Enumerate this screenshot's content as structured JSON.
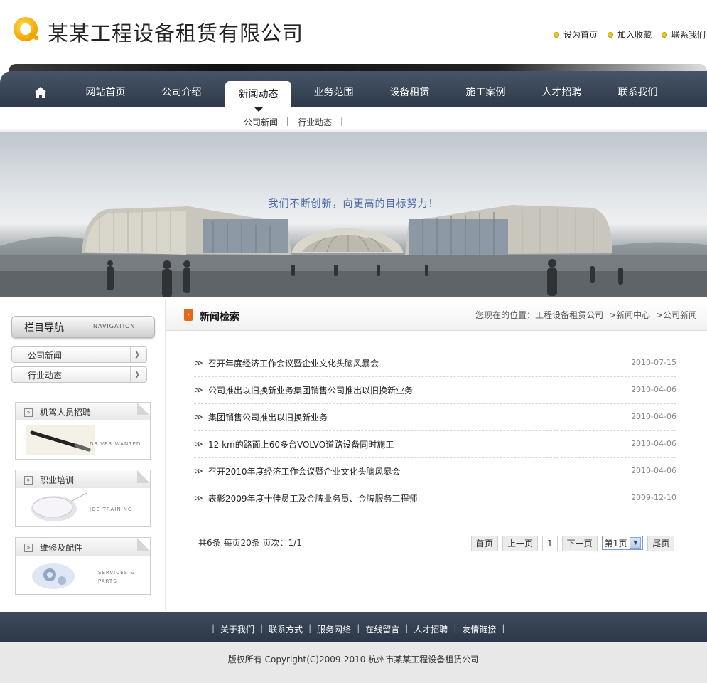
{
  "header": {
    "company_name": "某某工程设备租赁有限公司",
    "quick_links": [
      "设为首页",
      "加入收藏",
      "联系我们"
    ]
  },
  "nav": {
    "items": [
      "网站首页",
      "公司介绍",
      "新闻动态",
      "业务范围",
      "设备租赁",
      "施工案例",
      "人才招聘",
      "联系我们"
    ],
    "active": "新闻动态",
    "subnav": [
      "公司新闻",
      "行业动态"
    ]
  },
  "banner": {
    "slogan": "我们不断创新，向更高的目标努力！"
  },
  "sidebar": {
    "heading": "栏目导航",
    "heading_en": "NAVIGATION",
    "items": [
      "公司新闻",
      "行业动态"
    ],
    "promos": [
      {
        "title": "机驾人员招聘",
        "en": "DRIVER WANTED"
      },
      {
        "title": "职业培训",
        "en": "JOB TRAINING"
      },
      {
        "title": "维修及配件",
        "en_line1": "SERVICES &",
        "en_line2": "PARTS"
      }
    ]
  },
  "main": {
    "title": "新闻检索",
    "breadcrumb": {
      "prefix": "您现在的位置：",
      "items": [
        "工程设备租赁公司",
        "新闻中心",
        "公司新闻"
      ]
    },
    "news": [
      {
        "title": "召开年度经济工作会议暨企业文化头脑风暴会",
        "date": "2010-07-15"
      },
      {
        "title": "公司推出以旧换新业务集团销售公司推出以旧换新业务",
        "date": "2010-04-06"
      },
      {
        "title": "集团销售公司推出以旧换新业务",
        "date": "2010-04-06"
      },
      {
        "title": "12 km的路面上60多台VOLVO道路设备同时施工",
        "date": "2010-04-06"
      },
      {
        "title": "召开2010年度经济工作会议暨企业文化头脑风暴会",
        "date": "2010-04-06"
      },
      {
        "title": "表彰2009年度十佳员工及金牌业务员、金牌服务工程师",
        "date": "2009-12-10"
      }
    ],
    "pager": {
      "info": "共6条  每页20条  页次：1/1",
      "first": "首页",
      "prev": "上一页",
      "current": "1",
      "next": "下一页",
      "select_value": "第1页",
      "last": "尾页"
    }
  },
  "footer": {
    "links": [
      "关于我们",
      "联系方式",
      "服务网络",
      "在线留言",
      "人才招聘",
      "友情链接"
    ],
    "copyright": "版权所有  Copyright(C)2009-2010 杭州市某某工程设备租赁公司"
  }
}
